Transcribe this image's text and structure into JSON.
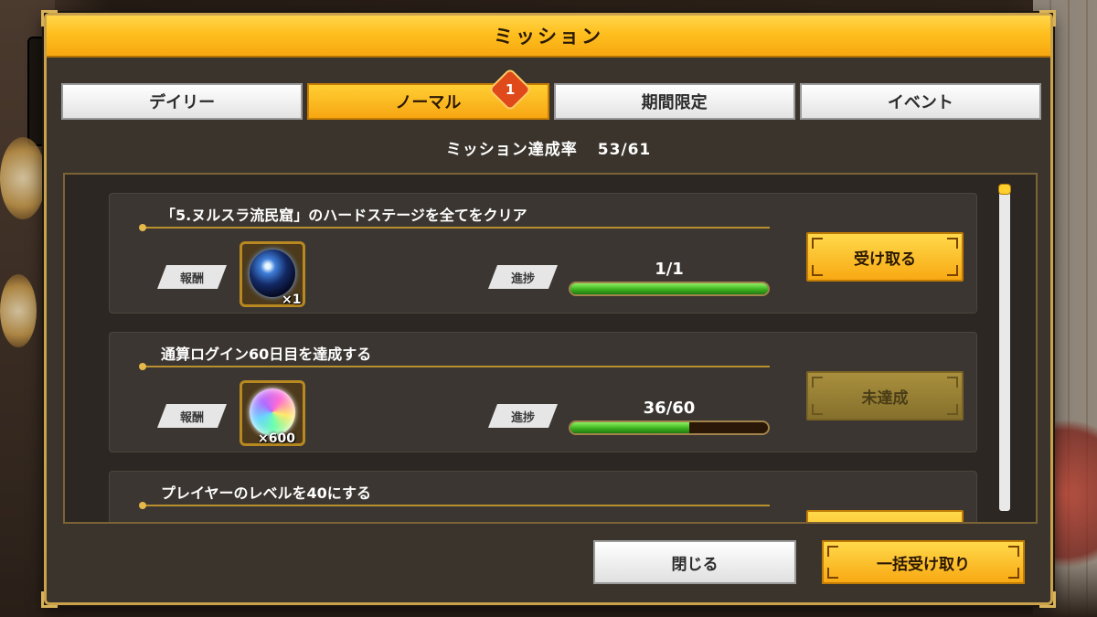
{
  "dialog": {
    "title": "ミッション"
  },
  "tabs": [
    {
      "label": "デイリー",
      "active": false
    },
    {
      "label": "ノーマル",
      "active": true,
      "badge": "1"
    },
    {
      "label": "期間限定",
      "active": false
    },
    {
      "label": "イベント",
      "active": false
    }
  ],
  "completion": {
    "label": "ミッション達成率",
    "value": "53/61"
  },
  "missions": [
    {
      "title": "「5.ヌルスラ流民窟」のハードステージを全てをクリア",
      "reward_label": "報酬",
      "reward_icon": "dark-orb-item-icon",
      "reward_qty": "×1",
      "progress_label": "進捗",
      "progress_text": "1/1",
      "progress": 1.0,
      "button": "受け取る",
      "button_state": "ready"
    },
    {
      "title": "通算ログイン60日目を達成する",
      "reward_label": "報酬",
      "reward_icon": "rainbow-gem-icon",
      "reward_qty": "×600",
      "progress_label": "進捗",
      "progress_text": "36/60",
      "progress": 0.6,
      "button": "未達成",
      "button_state": "disabled"
    },
    {
      "title": "プレイヤーのレベルを40にする"
    }
  ],
  "footer": {
    "close": "閉じる",
    "claim_all": "一括受け取り"
  },
  "colors": {
    "accent": "#f8a913",
    "progress_green": "#3db21f",
    "frame_gold": "#caa24b"
  }
}
